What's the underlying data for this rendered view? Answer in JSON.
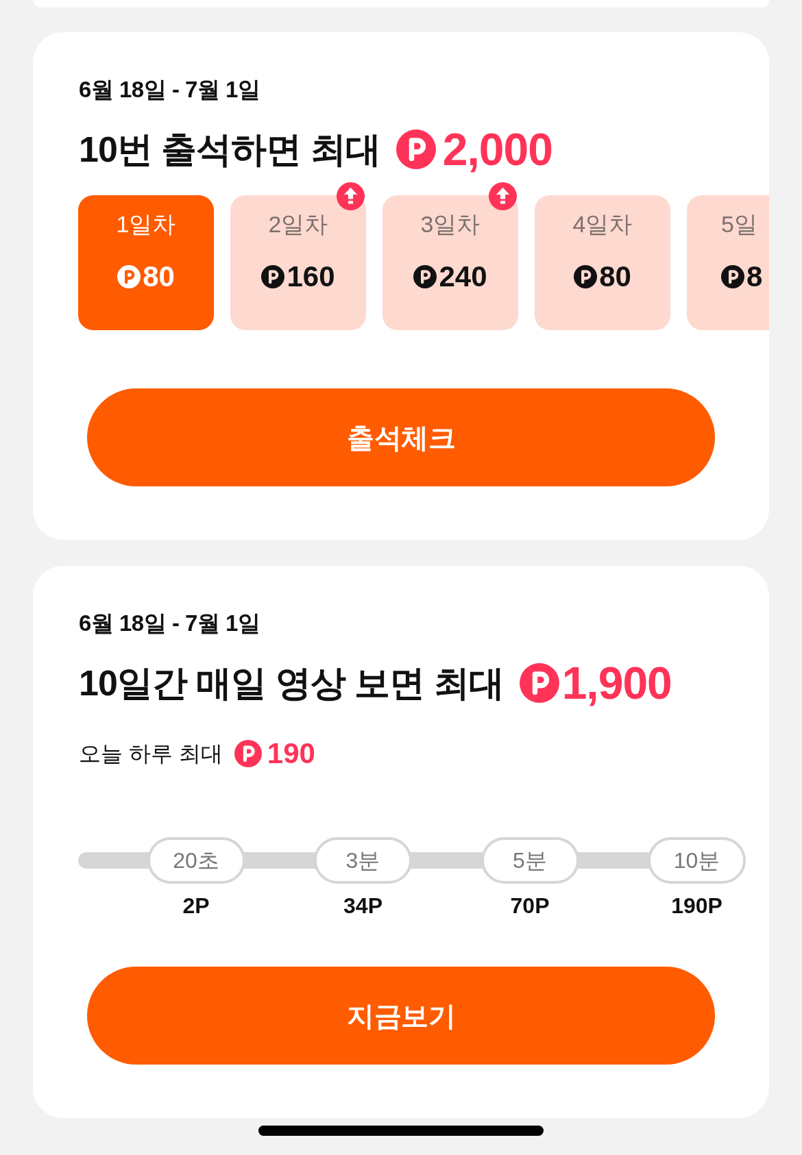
{
  "attendance": {
    "period": "6월 18일 - 7월 1일",
    "headline": "10번 출석하면 최대",
    "max_reward": "2,000",
    "days": [
      {
        "label": "1일차",
        "reward": "80",
        "current": true,
        "boosted": false,
        "cut_off": false
      },
      {
        "label": "2일차",
        "reward": "160",
        "current": false,
        "boosted": true,
        "cut_off": false
      },
      {
        "label": "3일차",
        "reward": "240",
        "current": false,
        "boosted": true,
        "cut_off": false
      },
      {
        "label": "4일차",
        "reward": "80",
        "current": false,
        "boosted": false,
        "cut_off": false
      },
      {
        "label": "5일",
        "reward": "8",
        "current": false,
        "boosted": false,
        "cut_off": true
      }
    ],
    "button": "출석체크"
  },
  "video": {
    "period": "6월 18일 - 7월 1일",
    "headline": "10일간 매일 영상 보면 최대",
    "max_reward": "1,900",
    "today_label": "오늘 하루 최대",
    "today_reward": "190",
    "milestones": [
      {
        "duration": "20초",
        "reward": "2P"
      },
      {
        "duration": "3분",
        "reward": "34P"
      },
      {
        "duration": "5분",
        "reward": "70P"
      },
      {
        "duration": "10분",
        "reward": "190P"
      }
    ],
    "button": "지금보기"
  }
}
